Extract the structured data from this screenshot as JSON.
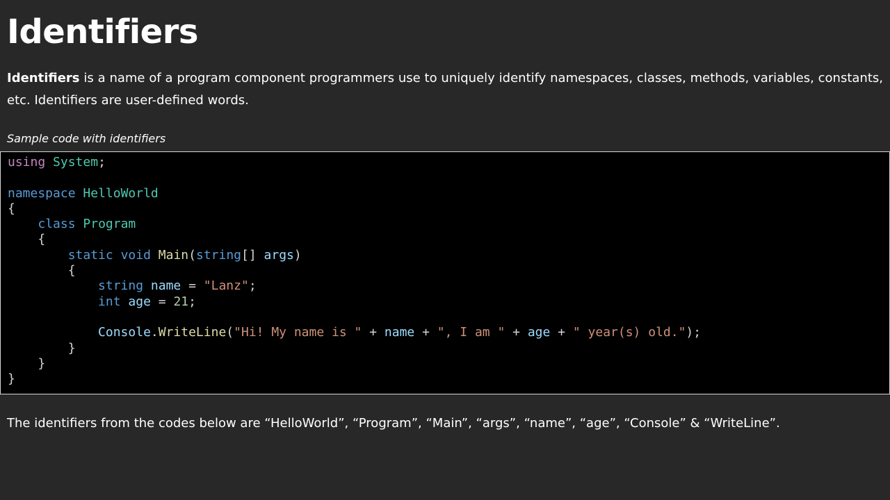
{
  "title": "Identifiers",
  "intro": {
    "term": "Identifiers",
    "text": " is a name of a program component programmers use to uniquely identify namespaces, classes, methods, variables, constants, etc. Identifiers are user-defined words."
  },
  "caption": "Sample code with identifiers",
  "code": {
    "language": "csharp",
    "lines": [
      [
        {
          "t": "using",
          "k": "ctl"
        },
        {
          "t": " "
        },
        {
          "t": "System",
          "k": "type"
        },
        {
          "t": ";"
        }
      ],
      [],
      [
        {
          "t": "namespace",
          "k": "kw"
        },
        {
          "t": " "
        },
        {
          "t": "HelloWorld",
          "k": "type"
        }
      ],
      [
        {
          "t": "{"
        }
      ],
      [
        {
          "t": "    "
        },
        {
          "t": "class",
          "k": "kw"
        },
        {
          "t": " "
        },
        {
          "t": "Program",
          "k": "type"
        }
      ],
      [
        {
          "t": "    {"
        }
      ],
      [
        {
          "t": "        "
        },
        {
          "t": "static",
          "k": "kw"
        },
        {
          "t": " "
        },
        {
          "t": "void",
          "k": "kw"
        },
        {
          "t": " "
        },
        {
          "t": "Main",
          "k": "fn"
        },
        {
          "t": "("
        },
        {
          "t": "string",
          "k": "kw"
        },
        {
          "t": "[] "
        },
        {
          "t": "args",
          "k": "var"
        },
        {
          "t": ")"
        }
      ],
      [
        {
          "t": "        {"
        }
      ],
      [
        {
          "t": "            "
        },
        {
          "t": "string",
          "k": "kw"
        },
        {
          "t": " "
        },
        {
          "t": "name",
          "k": "var"
        },
        {
          "t": " = "
        },
        {
          "t": "\"Lanz\"",
          "k": "str"
        },
        {
          "t": ";"
        }
      ],
      [
        {
          "t": "            "
        },
        {
          "t": "int",
          "k": "kw"
        },
        {
          "t": " "
        },
        {
          "t": "age",
          "k": "var"
        },
        {
          "t": " = "
        },
        {
          "t": "21",
          "k": "num"
        },
        {
          "t": ";"
        }
      ],
      [],
      [
        {
          "t": "            "
        },
        {
          "t": "Console",
          "k": "var"
        },
        {
          "t": "."
        },
        {
          "t": "WriteLine",
          "k": "fn"
        },
        {
          "t": "("
        },
        {
          "t": "\"Hi! My name is \"",
          "k": "str"
        },
        {
          "t": " + "
        },
        {
          "t": "name",
          "k": "var"
        },
        {
          "t": " + "
        },
        {
          "t": "\", I am \"",
          "k": "str"
        },
        {
          "t": " + "
        },
        {
          "t": "age",
          "k": "var"
        },
        {
          "t": " + "
        },
        {
          "t": "\" year(s) old.\"",
          "k": "str"
        },
        {
          "t": ");"
        }
      ],
      [
        {
          "t": "        }"
        }
      ],
      [
        {
          "t": "    }"
        }
      ],
      [
        {
          "t": "}"
        }
      ]
    ]
  },
  "summary": "The identifiers from the codes below are “HelloWorld”, “Program”, “Main”, “args”, “name”, “age”, “Console” & “WriteLine”.",
  "colors": {
    "background": "#282828",
    "code_background": "#000000",
    "keyword": "#569cd6",
    "control_keyword": "#c586c0",
    "type": "#4ec9b0",
    "function": "#dcdcaa",
    "variable": "#9cdcfe",
    "string": "#ce9178",
    "number": "#b5cea8",
    "punctuation": "#d4d4d4"
  }
}
